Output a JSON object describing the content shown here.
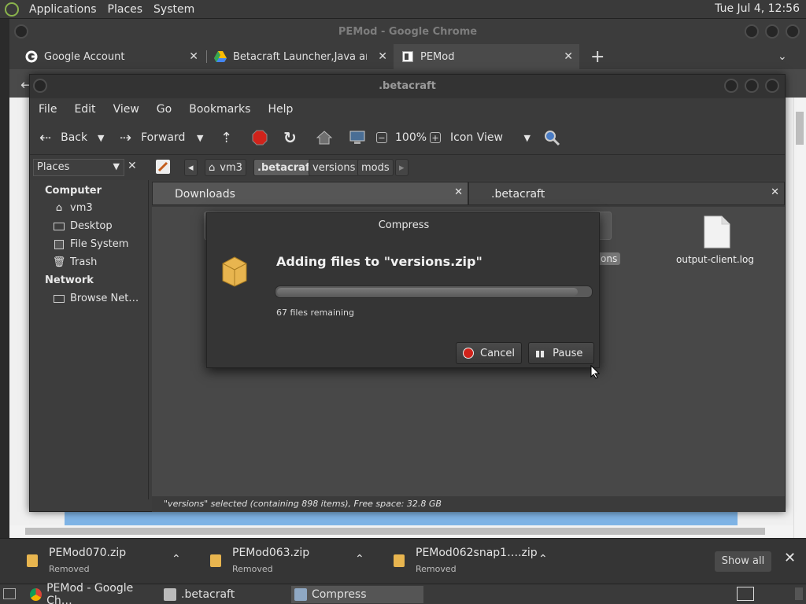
{
  "top_panel": {
    "menus": [
      "Applications",
      "Places",
      "System"
    ],
    "clock": "Tue Jul  4, 12:56"
  },
  "chrome": {
    "title": "PEMod - Google Chrome",
    "tabs": [
      {
        "label": "Google Account",
        "icon": "google-icon"
      },
      {
        "label": "Betacraft Launcher,Java and w",
        "icon": "google-drive-icon"
      },
      {
        "label": "PEMod",
        "icon": "page-icon"
      }
    ],
    "new_tab": "+",
    "tab_list_arrow": "⌄"
  },
  "caja": {
    "title": ".betacraft",
    "menu": [
      "File",
      "Edit",
      "View",
      "Go",
      "Bookmarks",
      "Help"
    ],
    "toolbar": {
      "back": "Back",
      "forward": "Forward",
      "zoom": "100%",
      "view_mode": "Icon View"
    },
    "places_label": "Places",
    "breadcrumb": [
      "vm3",
      ".betacraft",
      "versions",
      "mods"
    ],
    "sidebar": {
      "computer_header": "Computer",
      "computer_items": [
        "vm3",
        "Desktop",
        "File System",
        "Trash"
      ],
      "network_header": "Network",
      "network_items": [
        "Browse Net…"
      ]
    },
    "tabs": [
      "Downloads",
      ".betacraft"
    ],
    "files": [
      {
        "name": "output-client.log"
      },
      {
        "name": "ons"
      }
    ],
    "status": "\"versions\" selected (containing 898 items), Free space: 32.8 GB"
  },
  "compress": {
    "title": "Compress",
    "heading": "Adding files to \"versions.zip\"",
    "progress": 0.96,
    "remaining": "67 files remaining",
    "cancel_label": "Cancel",
    "pause_label": "Pause"
  },
  "downloads": {
    "items": [
      {
        "name": "PEMod070.zip",
        "status": "Removed"
      },
      {
        "name": "PEMod063.zip",
        "status": "Removed"
      },
      {
        "name": "PEMod062snap1….zip",
        "status": "Removed"
      }
    ],
    "show_all": "Show all"
  },
  "taskbar": {
    "tasks": [
      "PEMod - Google Ch…",
      ".betacraft",
      "Compress"
    ]
  },
  "colors": {
    "panel": "#3a3a3a",
    "zip_icon": "#e8b54f",
    "stop_red": "#d0231b"
  }
}
